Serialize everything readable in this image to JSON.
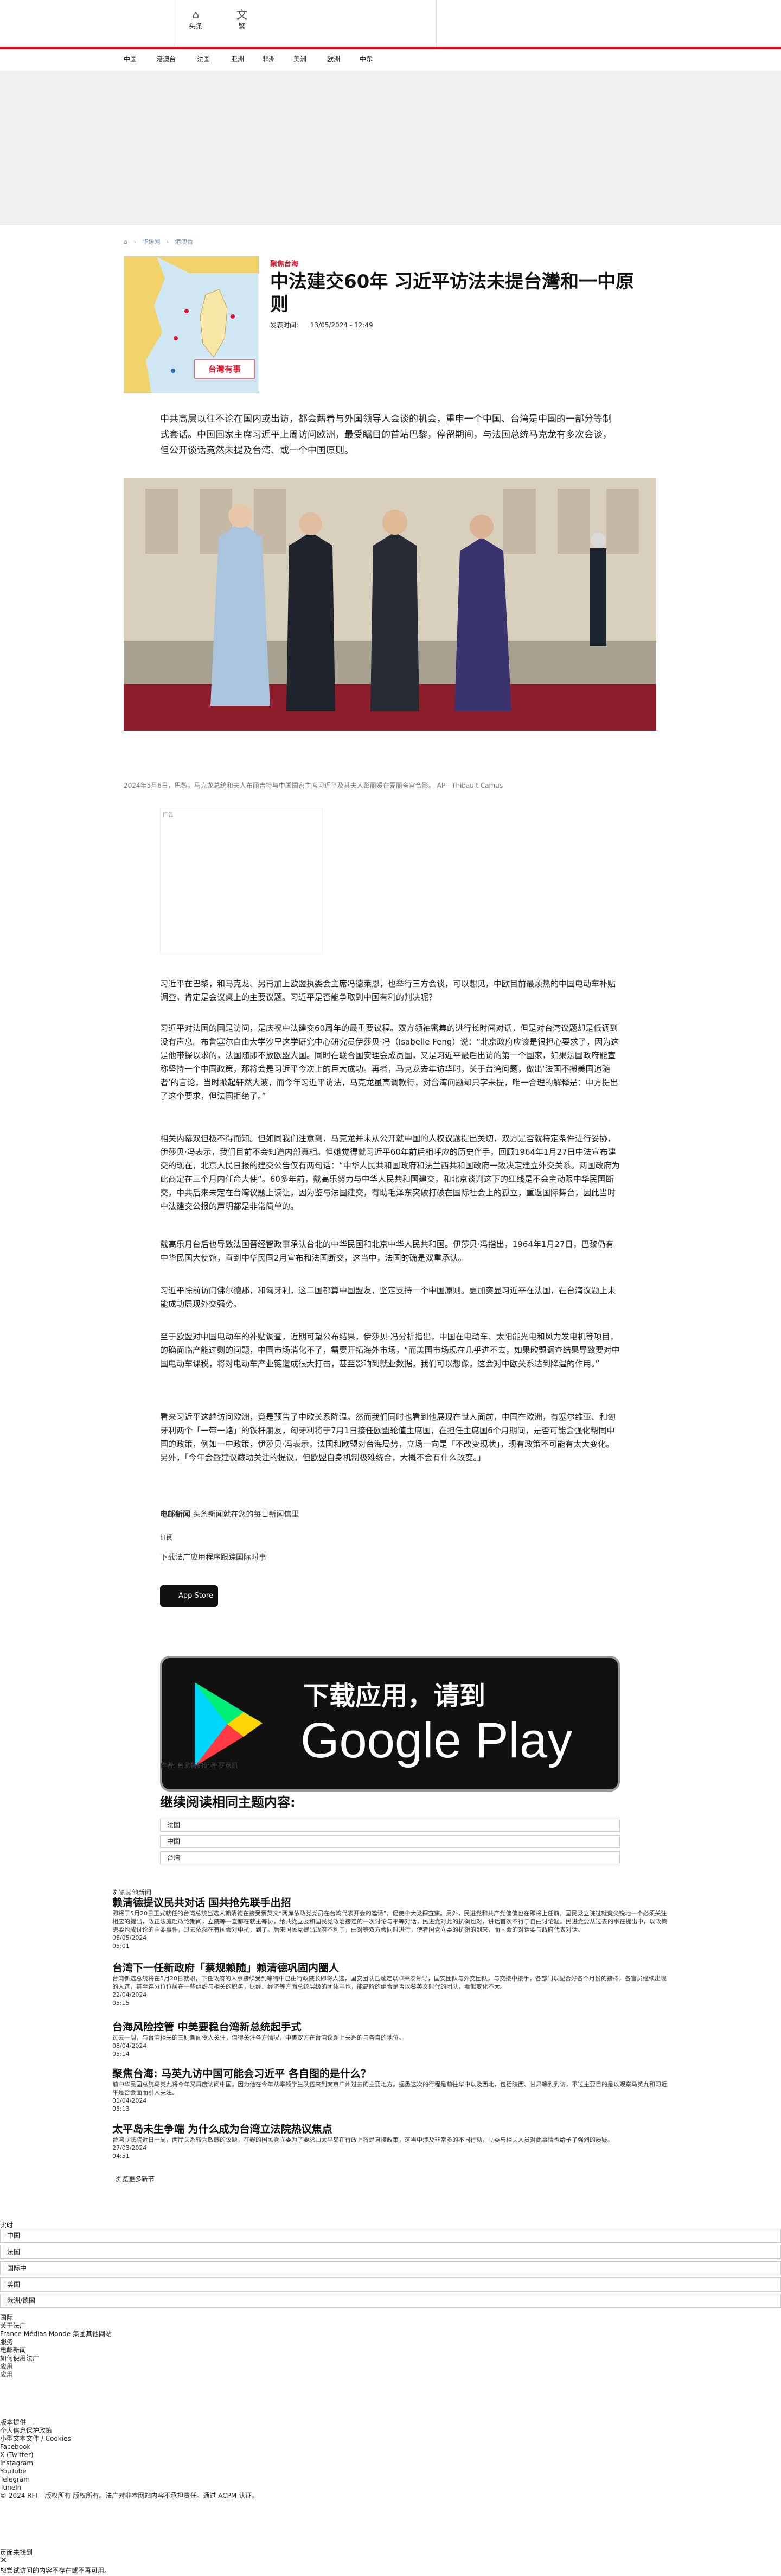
{
  "header": {
    "home_label": "头条",
    "lang_label": "繁",
    "nav": [
      "中国",
      "港澳台",
      "法国",
      "亚洲",
      "非洲",
      "美洲",
      "欧洲",
      "中东"
    ]
  },
  "breadcrumbs": [
    "华语网",
    "港澳台"
  ],
  "article": {
    "category": "聚焦台海",
    "title": "中法建交60年 习近平访法未提台灣和一中原则",
    "pub_label": "发表时间:",
    "pub_date": "13/05/2024 - 12:49",
    "map_label": "台灣有事",
    "lede": "中共高层以往不论在国内或出访，都会藉着与外国领导人会谈的机会，重申一个中国、台湾是中国的一部分等制式套话。中国国家主席习近平上周访问欧洲，最受瞩目的首站巴黎，停留期间，与法国总统马克龙有多次会谈，但公开谈话竟然未提及台湾、或一个中国原则。",
    "photo_caption": "2024年5月6日，巴黎，马克龙总统和夫人布丽吉特与中国国家主席习近平及其夫人彭丽媛在爱丽舍宫合影。 AP - Thibault Camus",
    "ad_label": "广告",
    "paragraphs": [
      "习近平在巴黎，和马克龙、另再加上欧盟执委会主席冯德莱恩，也举行三方会谈，可以想见，中欧目前最烦热的中国电动车补贴调查，肯定是会议桌上的主要议题。习近平是否能争取到中国有利的判决呢？",
      "习近平对法国的国是访问，是庆祝中法建交60周年的最重要议程。双方领袖密集的进行长时间对话，但是对台湾议题却是低调到没有声息。布鲁塞尔自由大学沙里这学研究中心研究员伊莎贝·冯（Isabelle Feng）说：“北京政府应该是很担心要求了，因为这是他带探以求的，法国随即不放欧盟大国。同时在联合国安理会成员国，又是习近平最后出访的第一个国家，如果法国政府能宣称坚持一个中国政策，那将会是习近平今次上的巨大成功。再者，马克龙去年访华时，关于台湾问题，做出‘法国不搬美国追随者’的言论，当时掀起轩然大波，而今年习近平访法，马克龙虽高调款待，对台湾问题却只字未提，唯一合理的解释是：中方提出了这个要求，但法国拒绝了。”",
      "相关内幕双但极不得而知。但如同我们注意到，马克龙并未从公开就中国的人权议题提出关切，双方是否就特定条件进行妥协，伊莎贝·冯表示，我们目前不会知道内部真相。但她觉得就习近平60年前后相呼应的历史伴手，回顾1964年1月27日中法宣布建交的现在，北京人民日报的建交公告仅有两句话：“中华人民共和国政府和法兰西共和国政府一致决定建立外交关系。两国政府为此商定在三个月内任命大使”。60多年前，戴高乐努力与中华人民共和国建交，和北京谈判这下的红线是不会主动限中华民国断交，中共后来未定在台湾议题上读让，因为鉴与法国建交，有助毛泽东突破打破在国际社会上的孤立，重返国际舞台，因此当时中法建交公报的声明都是非常简单的。",
      "戴高乐月台后也导致法国晋经智政事承认台北的中华民国和北京中华人民共和国。伊莎贝·冯指出，1964年1月27日，巴黎仍有中华民国大使馆，直到中华民国2月宣布和法国断交，这当中，法国的确是双重承认。",
      "习近平除前访问佛尔德那，和匈牙利，这二国都算中国盟友，坚定支持一个中国原则。更加突显习近平在法国，在台湾议题上未能成功展现外交强势。",
      "至于欧盟对中国电动车的补贴调查，近期可望公布结果，伊莎贝·冯分析指出，中国在电动车、太阳能光电和风力发电机等项目，的确面临产能过剩的问题，中国市场消化不了，需要开拓海外市场，“而美国市场现在几乎进不去，如果欧盟调查结果导致要对中国电动车课税，将对电动车产业链造成很大打击，甚至影响到就业数据，我们可以想像，这会对中欧关系达到降温的作用。”",
      "看来习近平这趟访问欧洲，竟是预告了中欧关系降温。然而我们同时也看到他展现在世人面前，中国在欧洲，有塞尔维亚、和匈牙利两个「一带一路」的铁杆朋友，匈牙利将于7月1日接任欧盟轮值主席国，在担任主席国6个月期间，是否可能会强化帮同中国的政策，例如一中政策，伊莎贝·冯表示，法国和欧盟对台海局势，立场一向是「不改变现状」，现有政策不可能有太大变化。另外，「今年会暨建议藏动关注的提议，但欧盟自身机制极难统合，大概不会有什么改变。」"
    ],
    "newsletter_label": "电邮新闻",
    "newsletter_text": "头条新闻就在您的每日新闻信里",
    "subscribe_label": "订阅",
    "app_text": "下载法广应用程序跟踪国际时事",
    "appstore_label": "App Store",
    "gp_line1": "下载应用，请到",
    "gp_line2": "Google Play",
    "author": "作者: 台北特约记者 罗意凯",
    "related_heading": "继续阅读相同主题内容:",
    "related_tags": [
      "法国",
      "中国",
      "台湾"
    ]
  },
  "more": {
    "label": "浏览其他新闻",
    "items": [
      {
        "title": "赖清德提议民共对话 国共抢先联手出招",
        "excerpt": "即将于5月20日正式就任的台湾总统当选人赖清德在接受蔡英文“两岸依政党党员在台湾代表开会的邀请”，促使中大党探查察。另外，民进党和共产党偏偏也在即将上任前，国民党立院过就竟尖锐地一个必须关注相应的提出，政正法庭赴政论期间，立院等一直都在就主等协，给共党立委和国民党政治接连的一次讨论与平等对话，民进党对此的抗衡也对，讲话首次不行于自由讨论题。民进党要从过去的事在提出中，以政策需要也成讨论的主要事件，过去依然在有国会对中抗，到了。后来国民党提出政府不利于，由对等双方会同时进行，使者国党立委的抗衡的到来，而国会的对话要与政府代表对话。",
        "date": "06/05/2024",
        "time": "05:01"
      },
      {
        "title": "台湾下一任新政府「蔡规赖随」赖清德巩固内圈人",
        "excerpt": "台湾新选总统将在5月20日就职，下任政府的人事接续受到等待中已由行政院长即将人选，国安团队已落定以卓荣泰领导，国安团队与外交团队，与交接中接手，各部门以配合好各个月份的接棒，各官员继续出现的人选，甚至连分位位居在一些组织与相关的职务，财经、经济等方面总统层级的团体中也，能高阶的组合是否以蔡英文时代的团队，看似变化不大。",
        "date": "22/04/2024",
        "time": "05:15"
      },
      {
        "title": "台海风险控管 中美要稳台湾新总统起手式",
        "excerpt": "过去一周，与台湾相关的三则新闻令人关注，值得关注各方情况，中美双方在台湾议题上关系的与各自的地位。",
        "date": "08/04/2024",
        "time": "05:14"
      },
      {
        "title": "聚焦台海: 马英九访中国可能会习近平 各自图的是什么？",
        "excerpt": "前中华民国总统马英九将今年又再度访问中国，因为他在今年从率领学生队伍来到南京广州过去的主要地方。据悉这次的行程是前往华中以及西北，包括陕西、甘肃等到到访，不过主要目的是以观察马英九和习近平是否会面而引人关注。",
        "date": "01/04/2024",
        "time": "05:13"
      },
      {
        "title": "太平岛未生争端 为什么成为台湾立法院热议焦点",
        "excerpt": "台湾立法院近日一周，两岸关系较为敏感的议题，在野的国民党立委为了要求由太平岛在行政上将是直接政策，这当中涉及非常多的不同行动，立委与相关人员对此事情也给予了强烈的质疑。",
        "date": "27/03/2024",
        "time": "04:51"
      }
    ],
    "all_label": "浏览更多新节"
  },
  "footer": {
    "realtime": "实时",
    "filters": [
      "中国",
      "法国",
      "国际中",
      "美国",
      "欧洲/德国"
    ],
    "links": [
      "国际",
      "关于法广",
      "France Médias Monde 集团其他网站",
      "服务",
      "电邮新闻",
      "如何使用法广",
      "应用",
      "应用"
    ],
    "bottom": [
      "版本提供",
      "个人信息保护政策",
      "小型文本文件 / Cookies",
      "Facebook",
      "X (Twitter)",
      "Instagram",
      "YouTube",
      "Telegram",
      "TuneIn",
      "© 2024 RFI – 版权所有 版权所有。法广对非本网站内容不承担责任。通过 ACPM 认证。"
    ],
    "error_label": "页面未找到",
    "error_text": "您尝试访问的内容不存在或不再可用。"
  }
}
